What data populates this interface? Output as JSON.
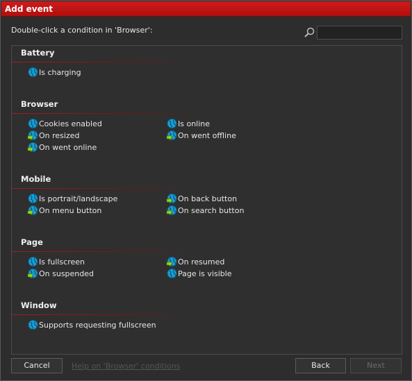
{
  "window": {
    "title": "Add event"
  },
  "instruction": "Double-click a condition in 'Browser':",
  "search": {
    "value": "",
    "placeholder": ""
  },
  "categories": [
    {
      "title": "Battery",
      "left": [
        {
          "label": "Is charging",
          "icon": "condition-globe-icon"
        }
      ],
      "right": []
    },
    {
      "title": "Browser",
      "left": [
        {
          "label": "Cookies enabled",
          "icon": "condition-globe-icon"
        },
        {
          "label": "On resized",
          "icon": "trigger-globe-icon"
        },
        {
          "label": "On went online",
          "icon": "trigger-globe-icon"
        }
      ],
      "right": [
        {
          "label": "Is online",
          "icon": "condition-globe-icon"
        },
        {
          "label": "On went offline",
          "icon": "trigger-globe-icon"
        }
      ]
    },
    {
      "title": "Mobile",
      "left": [
        {
          "label": "Is portrait/landscape",
          "icon": "condition-globe-icon"
        },
        {
          "label": "On menu button",
          "icon": "trigger-globe-icon"
        }
      ],
      "right": [
        {
          "label": "On back button",
          "icon": "trigger-globe-icon"
        },
        {
          "label": "On search button",
          "icon": "trigger-globe-icon"
        }
      ]
    },
    {
      "title": "Page",
      "left": [
        {
          "label": "Is fullscreen",
          "icon": "condition-globe-icon"
        },
        {
          "label": "On suspended",
          "icon": "trigger-globe-icon"
        }
      ],
      "right": [
        {
          "label": "On resumed",
          "icon": "trigger-globe-icon"
        },
        {
          "label": "Page is visible",
          "icon": "condition-globe-icon"
        }
      ]
    },
    {
      "title": "Window",
      "left": [
        {
          "label": "Supports requesting fullscreen",
          "icon": "condition-globe-icon"
        }
      ],
      "right": []
    }
  ],
  "footer": {
    "cancel_label": "Cancel",
    "help_label": "Help on 'Browser' conditions",
    "back_label": "Back",
    "next_label": "Next"
  },
  "colors": {
    "titlebar": "#c41414",
    "accent_line": "#9a2020",
    "globe": "#1a9fd6",
    "trigger_arrow": "#8fd61a"
  }
}
